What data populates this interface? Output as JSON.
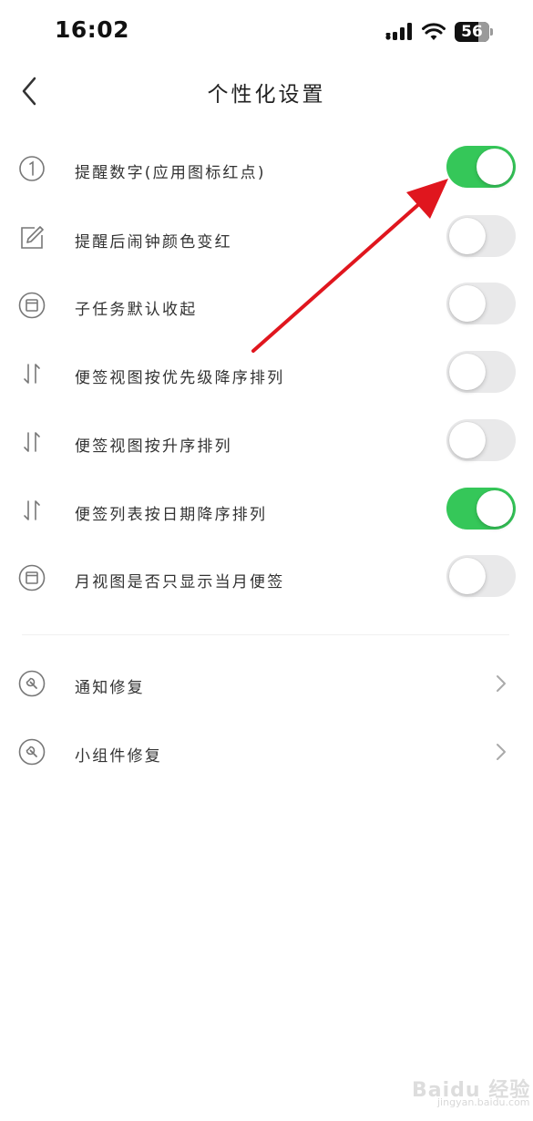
{
  "status_bar": {
    "time": "16:02",
    "battery_level": "56"
  },
  "nav": {
    "title": "个性化设置"
  },
  "settings": [
    {
      "label": "提醒数字(应用图标红点)",
      "icon": "number-1-circle-icon",
      "enabled": true
    },
    {
      "label": "提醒后闹钟颜色变红",
      "icon": "edit-icon",
      "enabled": false
    },
    {
      "label": "子任务默认收起",
      "icon": "collapse-box-icon",
      "enabled": false
    },
    {
      "label": "便签视图按优先级降序排列",
      "icon": "sort-icon",
      "enabled": false
    },
    {
      "label": "便签视图按升序排列",
      "icon": "sort-icon",
      "enabled": false
    },
    {
      "label": "便签列表按日期降序排列",
      "icon": "sort-icon",
      "enabled": true
    },
    {
      "label": "月视图是否只显示当月便签",
      "icon": "calendar-box-icon",
      "enabled": false
    }
  ],
  "repair_items": [
    {
      "label": "通知修复",
      "icon": "wrench-icon"
    },
    {
      "label": "小组件修复",
      "icon": "wrench-icon"
    }
  ],
  "colors": {
    "toggle_on": "#35c759",
    "toggle_off": "#e9e9ea",
    "arrow": "#e0161e"
  },
  "watermark": {
    "brand": "Baidu 经验",
    "domain": "jingyan.baidu.com"
  }
}
